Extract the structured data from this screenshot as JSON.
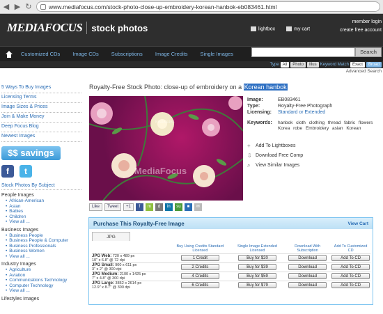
{
  "browser": {
    "url": "www.mediafocus.com/stock-photo-close-up-embroidery-korean-hanbok-eb083461.html"
  },
  "header": {
    "logo": "MEDIAFOCUS",
    "tagline": "stock photos",
    "lightbox": "lightbox",
    "cart": "my cart",
    "member_login": "member login",
    "create_account": "create free account"
  },
  "nav": {
    "items": [
      "Customized CDs",
      "Image CDs",
      "Subscriptions",
      "Image Credits",
      "Single Images"
    ]
  },
  "search": {
    "button": "Search",
    "placeholder": ""
  },
  "filter": {
    "type_label": "Type",
    "types": [
      "All",
      "Photo",
      "Illus"
    ],
    "match_label": "Keyword Match",
    "matches": [
      "Exact",
      "Broad"
    ],
    "advanced": "Advanced Search"
  },
  "sidebar": {
    "links": [
      "5 Ways To Buy Images",
      "Licensing Terms",
      "Image Sizes & Prices",
      "Join & Make Money",
      "Deep Focus Blog",
      "Newest Images"
    ],
    "savings": "$$ savings",
    "by_subject": "Stock Photos By Subject",
    "groups": [
      {
        "title": "People Images",
        "items": [
          "African-American",
          "Asian",
          "Babies",
          "Children",
          "View all ..."
        ]
      },
      {
        "title": "Business Images",
        "items": [
          "Business People",
          "Business People & Computer",
          "Business Professionals",
          "Business Women",
          "View all ..."
        ]
      },
      {
        "title": "Industry Images",
        "items": [
          "Agriculture",
          "Aviation",
          "Communications Technology",
          "Computer Technology",
          "View all ..."
        ]
      }
    ],
    "lifestyles": "Lifestyles Images"
  },
  "page": {
    "title_prefix": "Royalty-Free Stock Photo:  close-up of embroidery on a ",
    "title_highlight": "Korean hanbok",
    "watermark": "MediaFocus",
    "photo_id_overlay": "EB083461"
  },
  "info": {
    "image_label": "Image:",
    "image_value": "EB083461",
    "type_label": "Type:",
    "type_value": "Royalty-Free Photograph",
    "licensing_label": "Licensing:",
    "licensing_value": "Standard or Extended",
    "keywords_label": "Keywords:",
    "keywords_value": "hanbok cloth clothing thread fabric flowers Korea robe Embroidery asian Korean"
  },
  "actions": {
    "add_lightbox": "Add To Lightboxes",
    "download_comp": "Download Free Comp",
    "view_similar": "View Similar Images"
  },
  "share": {
    "like": "Like",
    "tweet": "Tweet",
    "plus": "+1"
  },
  "purchase": {
    "title": "Purchase This Royalty-Free Image",
    "view_cart": "View Cart",
    "tab": "JPG",
    "columns": [
      "Buy Using Credits Standard Licensed",
      "Single Image Extended Licensed",
      "Download With Subscription",
      "Add To Customized CD"
    ],
    "rows": [
      {
        "name": "JPG Web:",
        "dims": "720 x 489 px",
        "sub": "10\" x 6.8\" @ 72 dpi",
        "credits": "1 Credit",
        "price": "Buy for $20",
        "download": "Download",
        "cd": "Add To CD"
      },
      {
        "name": "JPG Small:",
        "dims": "900 x 611 px",
        "sub": "3\" x 2\" @ 300 dpi",
        "credits": "2 Credits",
        "price": "Buy for $39",
        "download": "Download",
        "cd": "Add To CD"
      },
      {
        "name": "JPG Medium:",
        "dims": "2100 x 1425 px",
        "sub": "7\" x 4.8\" @ 300 dpi",
        "credits": "4 Credits",
        "price": "Buy for $59",
        "download": "Download",
        "cd": "Add To CD"
      },
      {
        "name": "JPG Large:",
        "dims": "3852 x 2614 px",
        "sub": "12.9\" x 8.7\" @ 300 dpi",
        "credits": "6 Credits",
        "price": "Buy for $79",
        "download": "Download",
        "cd": "Add To CD"
      }
    ]
  }
}
